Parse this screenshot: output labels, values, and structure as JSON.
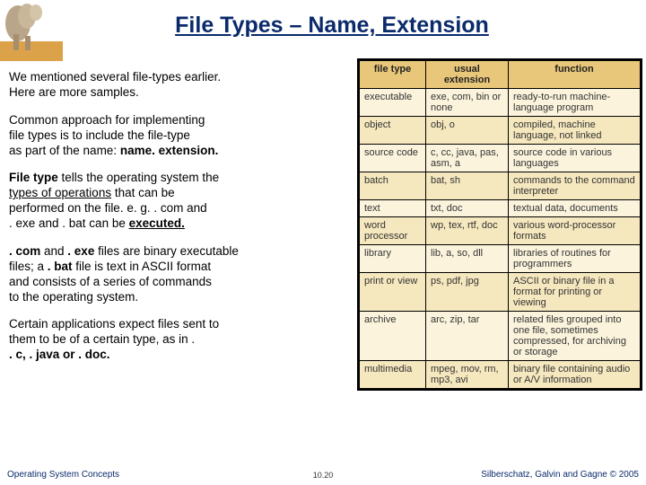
{
  "title": "File Types – Name, Extension",
  "paragraphs": {
    "p1a": "We mentioned several file-types earlier.",
    "p1b": "Here are more samples.",
    "p2a": "Common approach for implementing",
    "p2b": "file types is to include the file-type",
    "p2c": "as part of the name:  ",
    "p2d": "name. extension.",
    "p3a": "File type",
    "p3b": " tells the operating system the",
    "p3c": "types of operations",
    "p3d": " that can be",
    "p3e": "performed on the file. e. g.  . com and",
    "p3f": ". exe and . bat can be ",
    "p3g": "executed.",
    "p4a": ". com",
    "p4b": " and ",
    "p4c": ". exe",
    "p4d": " files are binary executable",
    "p4e": " files;  a ",
    "p4f": ". bat",
    "p4g": " file is text in ASCII format",
    "p4h": " and consists of a series of commands",
    "p4i": " to the operating system.",
    "p5a": "Certain applications expect files sent to",
    "p5b": " them to be of a certain type, as in .",
    "p5c": " . c,   . java or  . doc."
  },
  "table": {
    "headers": [
      "file type",
      "usual extension",
      "function"
    ],
    "rows": [
      [
        "executable",
        "exe, com, bin or none",
        "ready-to-run machine-language program"
      ],
      [
        "object",
        "obj, o",
        "compiled, machine language, not linked"
      ],
      [
        "source code",
        "c, cc, java, pas, asm, a",
        "source code in various languages"
      ],
      [
        "batch",
        "bat, sh",
        "commands to the command interpreter"
      ],
      [
        "text",
        "txt, doc",
        "textual data, documents"
      ],
      [
        "word processor",
        "wp, tex, rtf, doc",
        "various word-processor formats"
      ],
      [
        "library",
        "lib, a, so, dll",
        "libraries of routines for programmers"
      ],
      [
        "print or view",
        "ps, pdf, jpg",
        "ASCII or binary file in a format for printing or viewing"
      ],
      [
        "archive",
        "arc, zip, tar",
        "related files grouped into one file, sometimes compressed, for archiving or storage"
      ],
      [
        "multimedia",
        "mpeg, mov, rm, mp3, avi",
        "binary file containing audio or A/V information"
      ]
    ]
  },
  "footer": {
    "left": "Operating System Concepts",
    "center": "10.20",
    "right": "Silberschatz, Galvin and Gagne © 2005"
  }
}
